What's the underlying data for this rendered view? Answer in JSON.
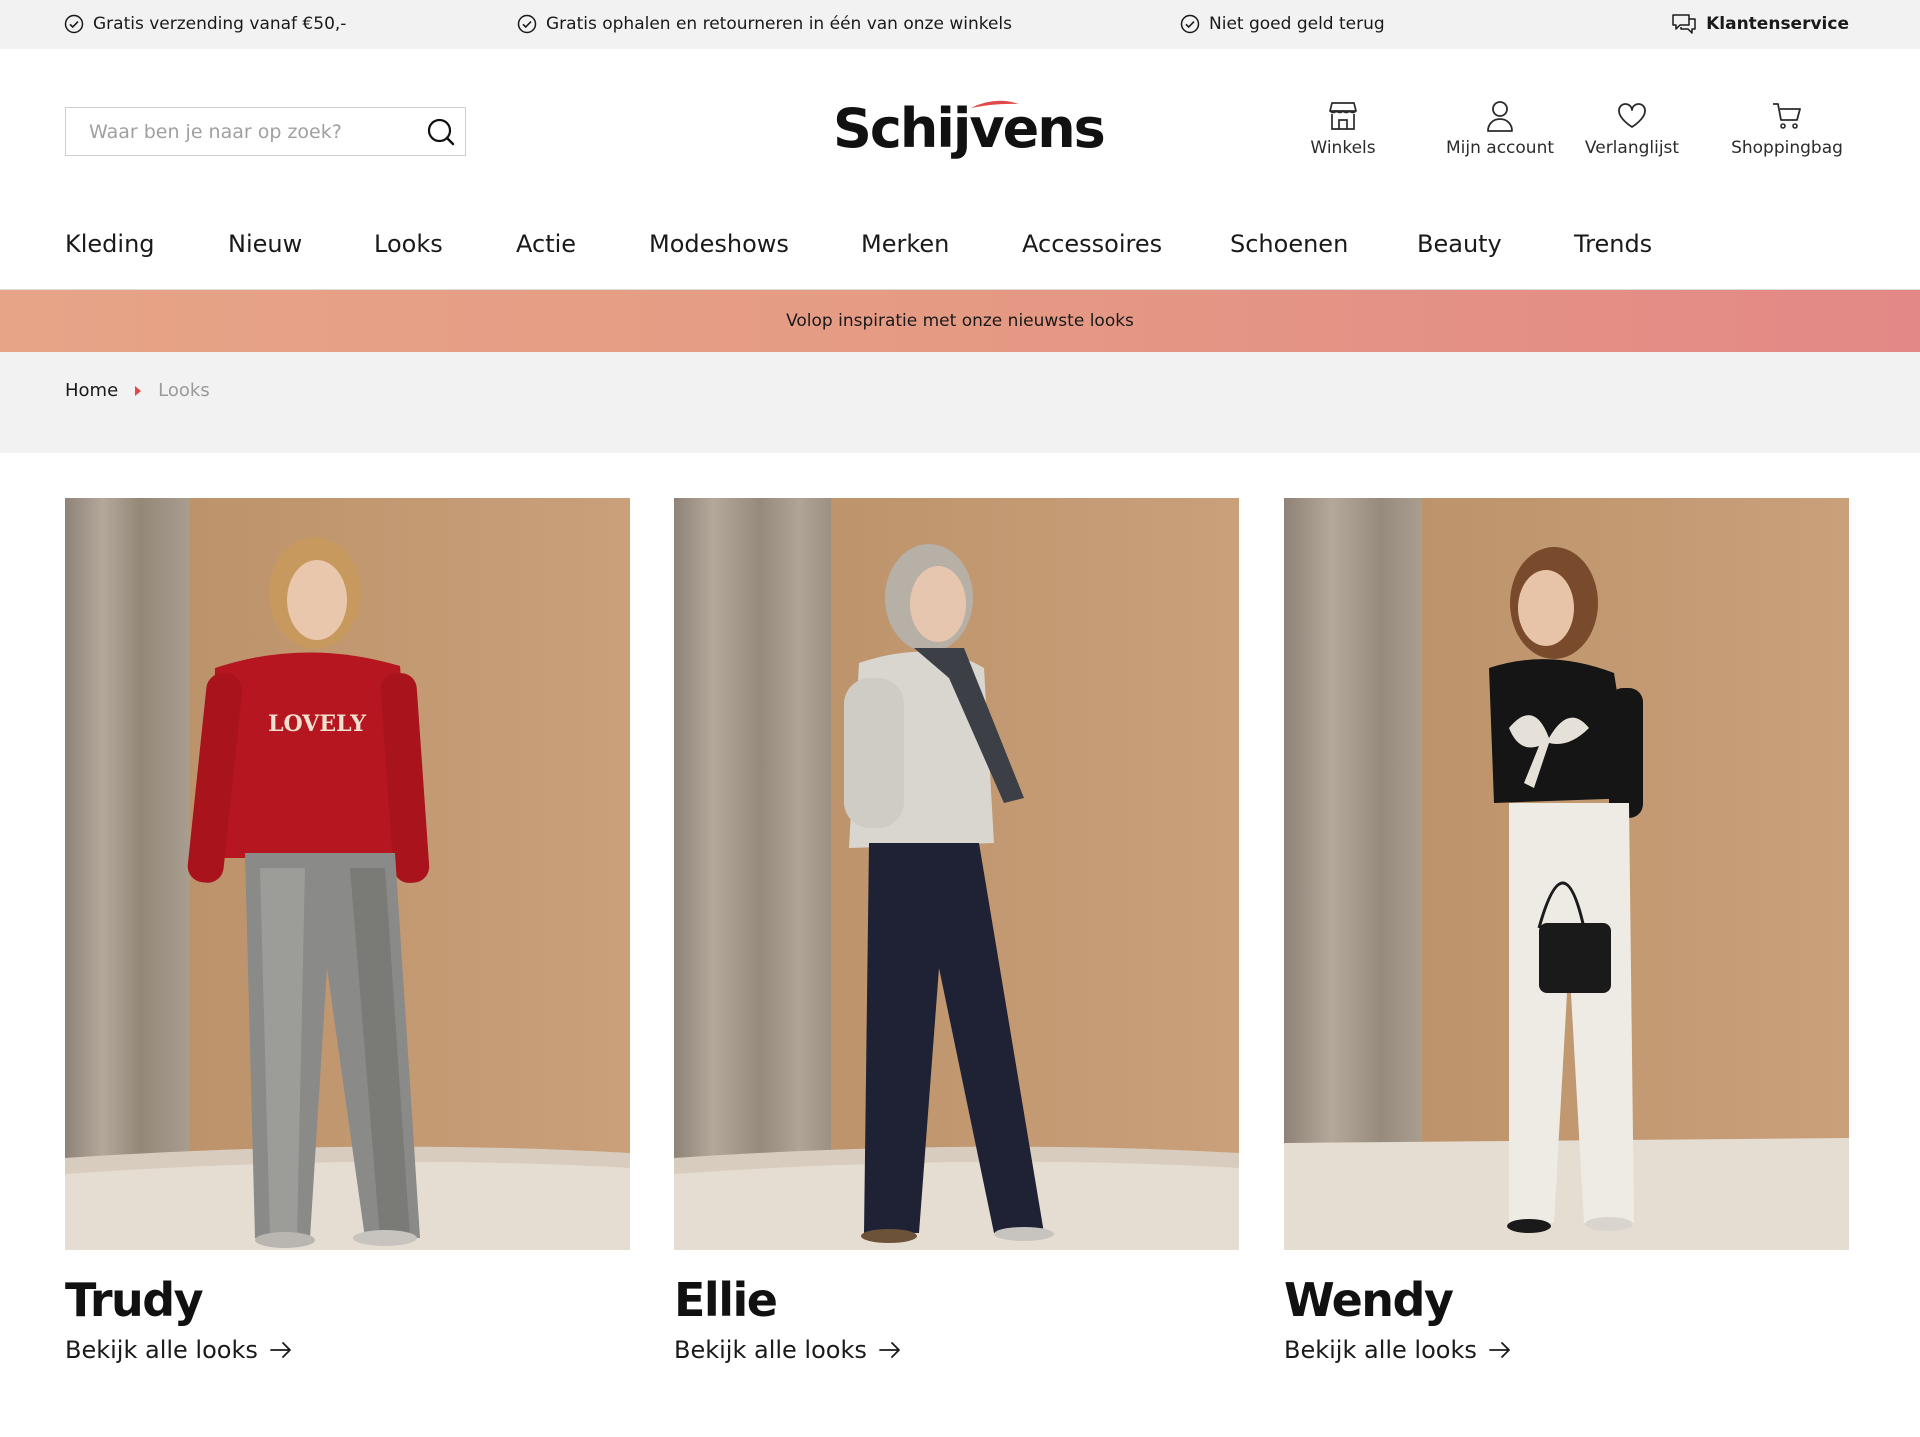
{
  "usp_bar": {
    "items": [
      {
        "label": "Gratis verzending vanaf €50,-",
        "icon": "check-circle-icon"
      },
      {
        "label": "Gratis ophalen en retourneren in één van onze winkels",
        "icon": "check-circle-icon"
      },
      {
        "label": "Niet goed geld terug",
        "icon": "check-circle-icon"
      }
    ],
    "service": {
      "label": "Klantenservice",
      "icon": "chat-bubble-icon"
    }
  },
  "header": {
    "search": {
      "placeholder": "Waar ben je naar op zoek?",
      "value": "",
      "icon": "search-icon"
    },
    "logo": "Schijvens",
    "actions": [
      {
        "label": "Winkels",
        "icon": "store-icon"
      },
      {
        "label": "Mijn account",
        "icon": "user-icon"
      },
      {
        "label": "Verlanglijst",
        "icon": "heart-icon"
      },
      {
        "label": "Shoppingbag",
        "icon": "cart-icon"
      }
    ]
  },
  "nav": {
    "items": [
      "Kleding",
      "Nieuw",
      "Looks",
      "Actie",
      "Modeshows",
      "Merken",
      "Accessoires",
      "Schoenen",
      "Beauty",
      "Trends"
    ]
  },
  "promo": {
    "text": "Volop inspiratie met onze nieuwste looks"
  },
  "breadcrumb": {
    "home": "Home",
    "separator_icon": "caret-right-icon",
    "current": "Looks"
  },
  "looks": [
    {
      "name": "Trudy",
      "link": "Bekijk alle looks",
      "link_icon": "arrow-right-icon"
    },
    {
      "name": "Ellie",
      "link": "Bekijk alle looks",
      "link_icon": "arrow-right-icon"
    },
    {
      "name": "Wendy",
      "link": "Bekijk alle looks",
      "link_icon": "arrow-right-icon"
    }
  ],
  "colors": {
    "accent": "#e0484a",
    "promo_start": "#e7a487",
    "promo_end": "#e38886",
    "top_bar": "#f2f2f2",
    "backdrop": "#c49a71"
  }
}
